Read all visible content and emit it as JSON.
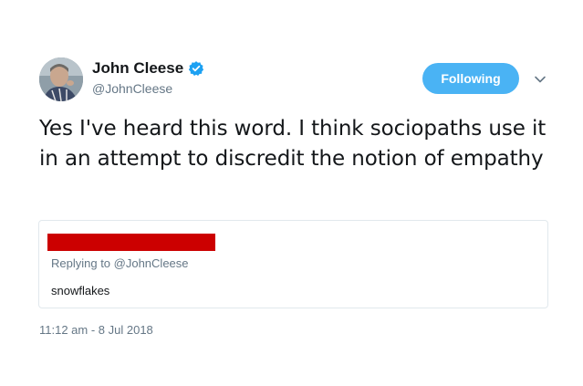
{
  "tweet": {
    "author": {
      "display_name": "John Cleese",
      "handle": "@JohnCleese",
      "verified": true,
      "avatar_icon": "profile-photo"
    },
    "follow_button_label": "Following",
    "menu_icon": "chevron-down-icon",
    "text": "Yes I've heard this word. I think sociopaths use it in an attempt to discredit the notion of empathy",
    "quoted_tweet": {
      "author_redacted": true,
      "redaction_color": "#cc0000",
      "replying_to": "Replying to @JohnCleese",
      "text": "snowflakes"
    },
    "timestamp": "11:12 am - 8 Jul 2018"
  },
  "colors": {
    "accent": "#4ab3f4",
    "verified": "#1da1f2",
    "secondary_text": "#657786",
    "primary_text": "#14171a",
    "border": "#e1e8ed"
  }
}
